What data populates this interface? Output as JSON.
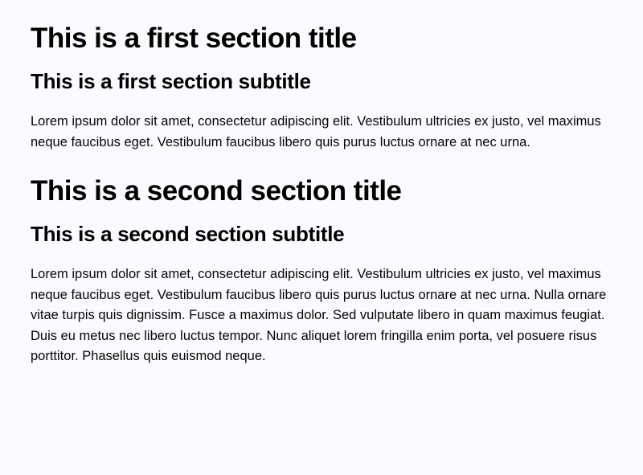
{
  "sections": [
    {
      "title": "This is a first section title",
      "subtitle": "This is a first section subtitle",
      "body": "Lorem ipsum dolor sit amet, consectetur adipiscing elit. Vestibulum ultricies ex justo, vel maximus neque faucibus eget. Vestibulum faucibus libero quis purus luctus ornare at nec urna."
    },
    {
      "title": "This is a second section title",
      "subtitle": "This is a second section subtitle",
      "body": "Lorem ipsum dolor sit amet, consectetur adipiscing elit. Vestibulum ultricies ex justo, vel maximus neque faucibus eget. Vestibulum faucibus libero quis purus luctus ornare at nec urna. Nulla ornare vitae turpis quis dignissim. Fusce a maximus dolor. Sed vulputate libero in quam maximus feugiat. Duis eu metus nec libero luctus tempor. Nunc aliquet lorem fringilla enim porta, vel posuere risus porttitor. Phasellus quis euismod neque."
    }
  ]
}
